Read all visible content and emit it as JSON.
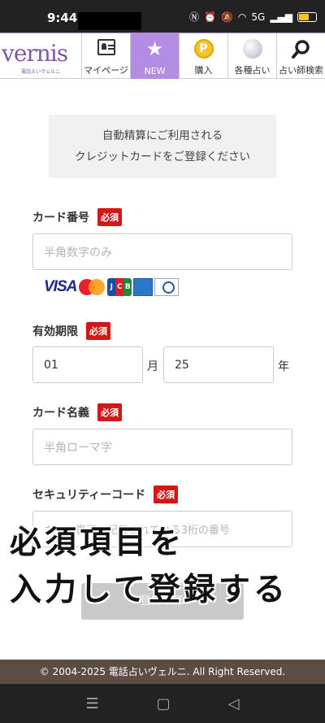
{
  "status_bar": {
    "time": "9:44",
    "network": "5G",
    "battery_color": "#f5c518"
  },
  "header": {
    "logo_text": "vernis",
    "logo_sub": "電話占いヴェルニ",
    "nav": [
      {
        "label": "マイページ",
        "icon": "member-card-icon"
      },
      {
        "label": "NEW",
        "icon": "star-icon",
        "active": true
      },
      {
        "label": "購入",
        "icon": "point-coin-icon"
      },
      {
        "label": "各種占い",
        "icon": "crystal-ball-icon"
      },
      {
        "label": "占い師検索",
        "icon": "search-icon"
      }
    ],
    "active_color": "#b48ce4"
  },
  "notice": {
    "line1": "自動精算にご利用される",
    "line2": "クレジットカードをご登録ください"
  },
  "required_label": "必須",
  "form": {
    "card_number": {
      "label": "カード番号",
      "placeholder": "半角数字のみ"
    },
    "card_brands": [
      "VISA",
      "Mastercard",
      "JCB",
      "American Express",
      "Diners Club"
    ],
    "expiry": {
      "label": "有効期限",
      "month": "01",
      "month_unit": "月",
      "year": "25",
      "year_unit": "年"
    },
    "card_name": {
      "label": "カード名義",
      "placeholder": "半角ローマ字"
    },
    "security_code": {
      "label": "セキュリティーコード",
      "placeholder": "カード裏面に記載されている3桁の番号"
    },
    "submit_label": "登録する"
  },
  "overlay": {
    "line1": "必須項目を",
    "line2": "入力して登録する"
  },
  "footer": {
    "copyright": "© 2004-2025 電話占いヴェルニ. All Right Reserved."
  },
  "system_nav": {
    "menu": "☰",
    "home": "▢",
    "back": "◁"
  }
}
